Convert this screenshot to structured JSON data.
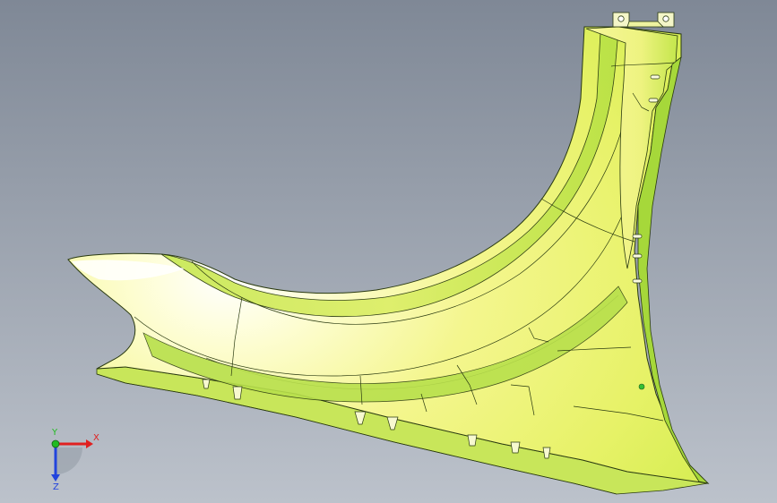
{
  "viewport": {
    "background_top": "#7f8896",
    "background_bottom": "#bcc2cb"
  },
  "part": {
    "fill_light": "#ffffe6",
    "fill_main": "#f2f58a",
    "fill_mid": "#e3ef5e",
    "fill_green": "#bfe448",
    "fill_deep": "#99cf2e",
    "edge_color": "#2a3a10"
  },
  "triad": {
    "x_label": "X",
    "y_label": "Y",
    "z_label": "Z",
    "x_color": "#e02020",
    "y_color": "#22bb22",
    "z_color": "#2244dd"
  }
}
